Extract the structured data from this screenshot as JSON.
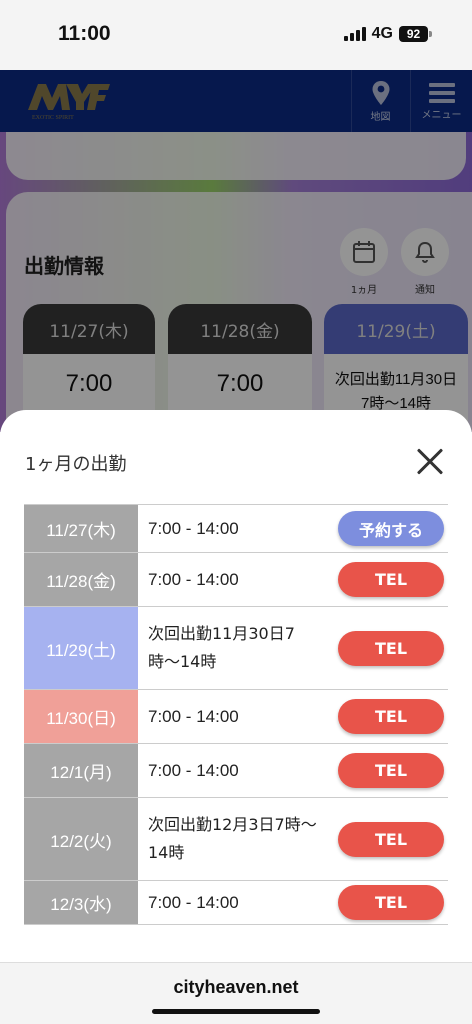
{
  "status": {
    "time": "11:00",
    "network": "4G",
    "battery": "92"
  },
  "header": {
    "logo_text": "EXOTIC SPIRIT",
    "buttons": [
      {
        "icon": "map-pin-icon",
        "label": "地図"
      },
      {
        "icon": "menu-icon",
        "label": "メニュー"
      }
    ]
  },
  "background": {
    "section_title": "出勤情報",
    "icon_buttons": [
      {
        "icon": "calendar-icon",
        "label": "1ヵ月"
      },
      {
        "icon": "bell-icon",
        "label": "通知"
      }
    ],
    "day_cards": [
      {
        "date": "11/27(木)",
        "time": "7:00"
      },
      {
        "date": "11/28(金)",
        "time": "7:00"
      },
      {
        "date": "11/29(土)",
        "time": "次回出勤11月30日7時〜14時"
      }
    ]
  },
  "sheet": {
    "title": "1ヶ月の出勤",
    "rows": [
      {
        "date": "11/27(木)",
        "time": "7:00 - 14:00",
        "action": "予約する",
        "date_color": "#a6a6a6",
        "button_color": "#7d8ede"
      },
      {
        "date": "11/28(金)",
        "time": "7:00 - 14:00",
        "action": "TEL",
        "date_color": "#a6a6a6",
        "button_color": "#e8544a"
      },
      {
        "date": "11/29(土)",
        "time": "次回出勤11月30日7時〜14時",
        "action": "TEL",
        "date_color": "#a6b2f0",
        "button_color": "#e8544a"
      },
      {
        "date": "11/30(日)",
        "time": "7:00 - 14:00",
        "action": "TEL",
        "date_color": "#f0a098",
        "button_color": "#e8544a"
      },
      {
        "date": "12/1(月)",
        "time": "7:00 - 14:00",
        "action": "TEL",
        "date_color": "#a6a6a6",
        "button_color": "#e8544a"
      },
      {
        "date": "12/2(火)",
        "time": "次回出勤12月3日7時〜14時",
        "action": "TEL",
        "date_color": "#a6a6a6",
        "button_color": "#e8544a"
      },
      {
        "date": "12/3(水)",
        "time": "7:00 - 14:00",
        "action": "TEL",
        "date_color": "#a6a6a6",
        "button_color": "#e8544a"
      }
    ]
  },
  "browser": {
    "url": "cityheaven.net"
  }
}
